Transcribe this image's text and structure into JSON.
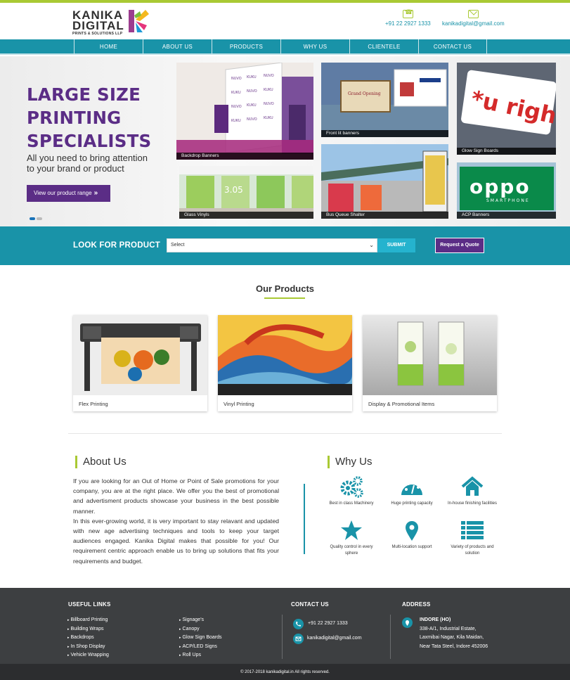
{
  "colors": {
    "brand_teal": "#1993a8",
    "brand_purple": "#5b2d86",
    "accent_green": "#a9c934",
    "footer_bg": "#3d3f41"
  },
  "brand": {
    "line1": "KANIKA",
    "line2": "DIGITAL",
    "line3": "PRINTS & SOLUTIONS LLP"
  },
  "header": {
    "phone": "+91 22 2927 1333",
    "email": "kanikadigital@gmail.com",
    "phone_icon": "phone-icon",
    "email_icon": "mail-icon"
  },
  "nav": [
    {
      "label": "HOME"
    },
    {
      "label": "ABOUT US"
    },
    {
      "label": "PRODUCTS"
    },
    {
      "label": "WHY US"
    },
    {
      "label": "CLIENTELE"
    },
    {
      "label": "CONTACT US"
    }
  ],
  "hero": {
    "title_line1": "LARGE SIZE",
    "title_line2": "PRINTING",
    "title_line3": "SPECIALISTS",
    "subtitle_line1": "All you need to bring attention",
    "subtitle_line2": "to your brand or product",
    "button_label": "View our product range",
    "button_icon": "double-chevron-right-icon",
    "tiles": [
      {
        "caption": "Backdrop Banners"
      },
      {
        "caption": "Glass Vinyls"
      },
      {
        "caption": "Front lit banners"
      },
      {
        "caption": "Bus Queue Shalter"
      },
      {
        "caption": "Glow Sign Boards"
      },
      {
        "caption": "ACP Banners"
      }
    ],
    "tile_texts": {
      "uright": "*u right",
      "oppo": "oppo",
      "smartphone": "SMARTPHONE",
      "glass_number": "3.05",
      "grand_opening": "Grand Opening"
    }
  },
  "search": {
    "label": "LOOK FOR PRODUCT",
    "select_value": "Select",
    "submit_label": "SUBMIT",
    "quote_label": "Request a Quote"
  },
  "products": {
    "title": "Our Products",
    "items": [
      {
        "label": "Flex Printing"
      },
      {
        "label": "Vinyl Printing"
      },
      {
        "label": "Display & Promotional Items"
      }
    ]
  },
  "about": {
    "title": "About Us",
    "para1": "If you are looking for an Out of Home or Point of Sale promotions for your company, you are at the right place. We offer you the best of promotional and advertisment products showcase your business in the best possible manner.",
    "para2": "In this ever-growing world, it is very important to stay relavant and updated with new age advertising techniques and tools to keep your target audiences engaged. Kanika Digital makes that possible for you! Our requirement centric approach enable us to bring up solutions that fits your requirements and budget."
  },
  "why": {
    "title": "Why Us",
    "items": [
      {
        "label": "Best in class Machinery",
        "icon": "gears-icon"
      },
      {
        "label": "Huge printing capacity",
        "icon": "dashboard-icon"
      },
      {
        "label": "In-house finishing facilities",
        "icon": "home-icon"
      },
      {
        "label": "Quality control in every sphere",
        "icon": "star-icon"
      },
      {
        "label": "Multi-location support",
        "icon": "map-marker-icon"
      },
      {
        "label": "Variety of products and solution",
        "icon": "list-icon"
      }
    ]
  },
  "footer": {
    "useful_links_title": "USEFUL LINKS",
    "links_col1": [
      "Billboard Printing",
      "Building Wraps",
      "Backdrops",
      "In Shop Display",
      "Vehicle Wrapping"
    ],
    "links_col2": [
      "Signage's",
      "Canopy",
      "Glow Sign Boards",
      "ACP/LED Signs",
      "Roll Ups"
    ],
    "contact_title": "CONTACT US",
    "phone": "+91 22 2927 1333",
    "email": "kanikadigital@gmail.com",
    "address_title": "ADDRESS",
    "address_name": "INDORE (HO)",
    "address_line1": "338-A/1, Industrial Estate,",
    "address_line2": "Laxmibai Nagar, Kila Maidan,",
    "address_line3": "Near Tata Steel, Indore 452006"
  },
  "copyright": "© 2017-2018 kanikadigital.in All rights reserved."
}
